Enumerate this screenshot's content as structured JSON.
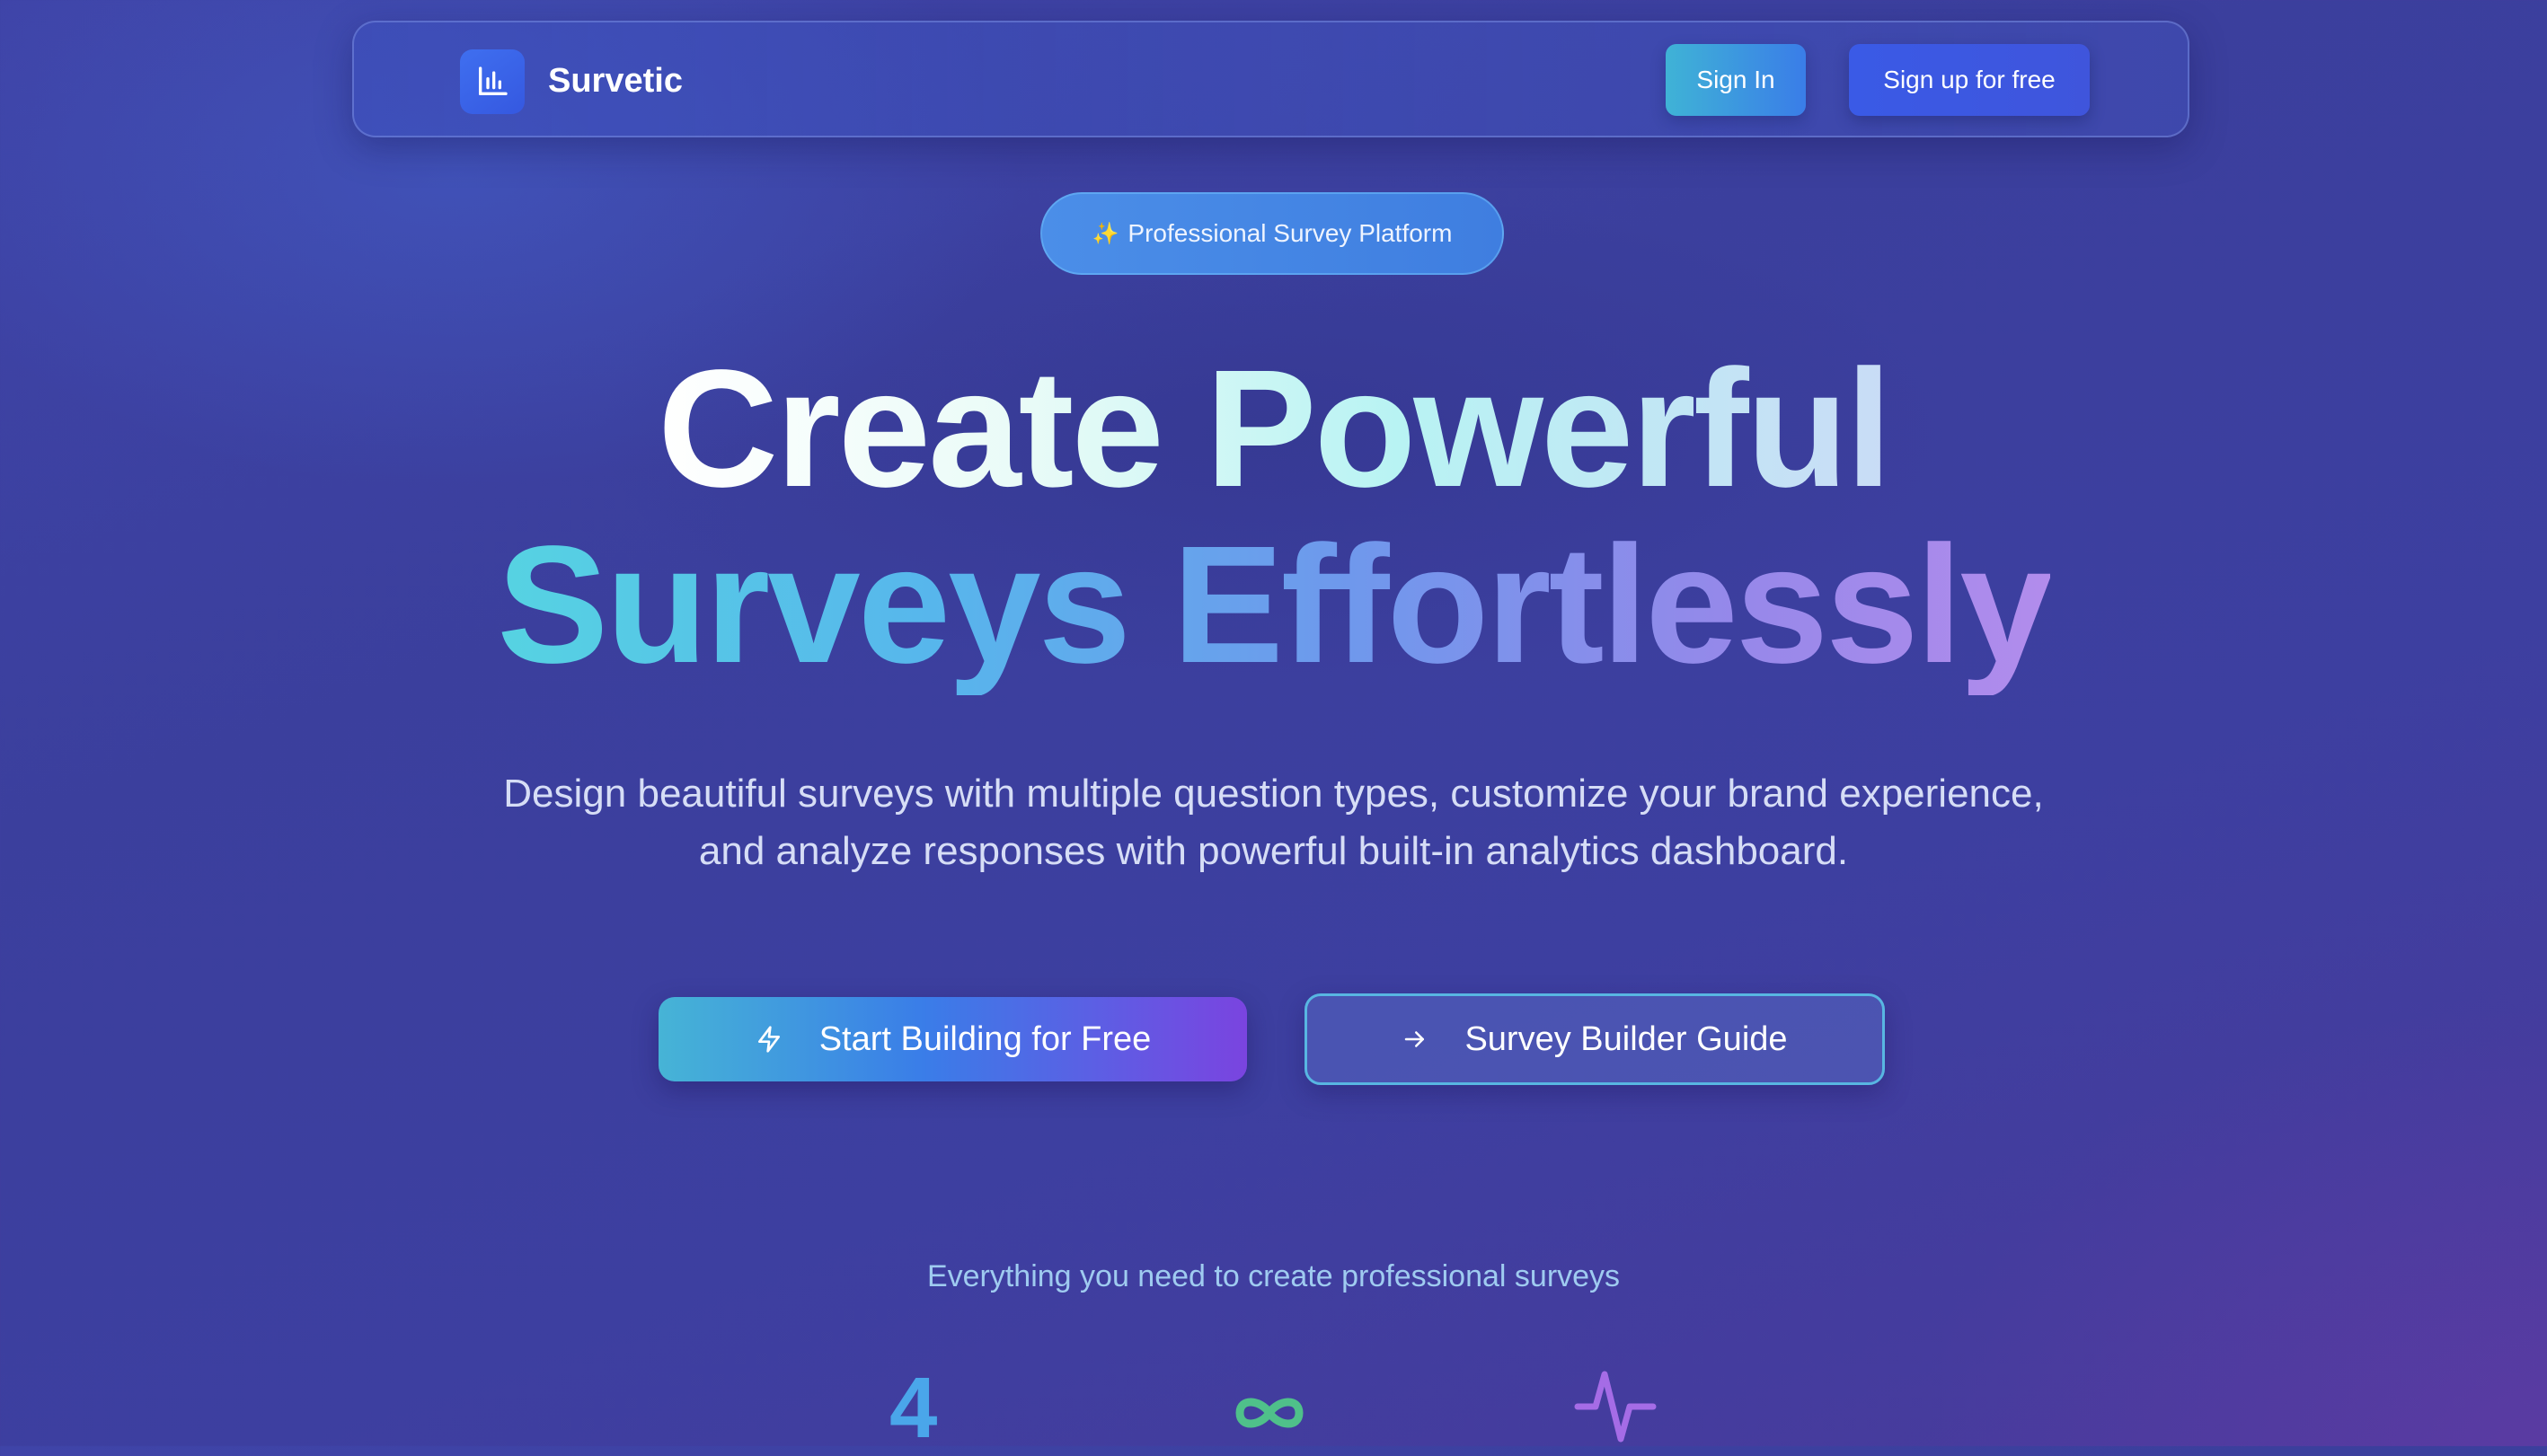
{
  "navbar": {
    "brand_name": "Survetic",
    "logo_icon": "bar-chart-icon",
    "signin_label": "Sign In",
    "signup_label": "Sign up for free"
  },
  "badge": {
    "icon": "sparkles-icon",
    "label": "Professional Survey Platform"
  },
  "hero": {
    "title_line1": "Create Powerful",
    "title_line2": "Surveys Effortlessly",
    "subtitle": "Design beautiful surveys with multiple question types, customize your brand experience, and analyze responses with powerful built-in analytics dashboard."
  },
  "cta": {
    "primary_label": "Start Building for Free",
    "primary_icon": "lightning-icon",
    "secondary_label": "Survey Builder Guide",
    "secondary_icon": "arrow-right-icon"
  },
  "features": {
    "caption": "Everything you need to create professional surveys",
    "stats": [
      {
        "value": "4",
        "color": "#4aa6ea"
      },
      {
        "icon": "infinity-icon",
        "color": "#4fc08a"
      },
      {
        "icon": "activity-icon",
        "color": "#a56ce6"
      }
    ]
  },
  "colors": {
    "background": "#3d41a2",
    "accent_blue": "#3a5ae6",
    "accent_cyan": "#46b4d6",
    "accent_purple": "#7a44e0"
  }
}
